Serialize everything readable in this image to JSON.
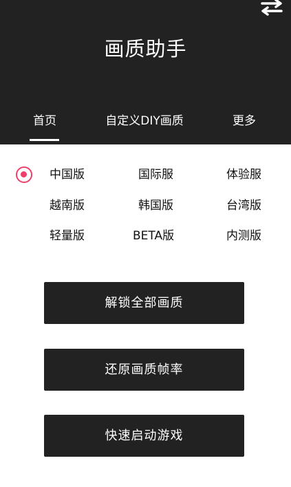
{
  "header": {
    "title": "画质助手",
    "swap_icon": "swap-arrows-icon"
  },
  "tabs": [
    {
      "label": "首页",
      "active": true
    },
    {
      "label": "自定义DIY画质",
      "active": false
    },
    {
      "label": "更多",
      "active": false
    }
  ],
  "versions": {
    "selected": "中国版",
    "items": [
      "中国版",
      "国际服",
      "体验服",
      "越南版",
      "韩国版",
      "台湾版",
      "轻量版",
      "BETA版",
      "内测版"
    ]
  },
  "actions": {
    "unlock_label": "解锁全部画质",
    "restore_label": "还原画质帧率",
    "launch_label": "快速启动游戏"
  },
  "colors": {
    "header_bg": "#222222",
    "accent": "#ee3e6a",
    "button_bg": "#222222"
  }
}
